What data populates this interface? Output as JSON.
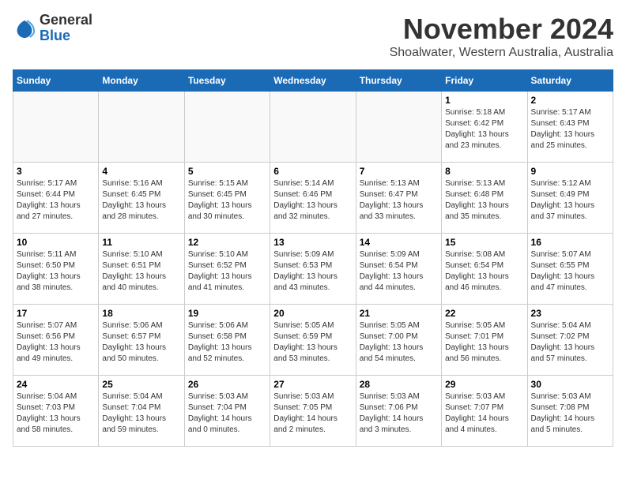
{
  "header": {
    "logo_line1": "General",
    "logo_line2": "Blue",
    "month_title": "November 2024",
    "location": "Shoalwater, Western Australia, Australia"
  },
  "days_of_week": [
    "Sunday",
    "Monday",
    "Tuesday",
    "Wednesday",
    "Thursday",
    "Friday",
    "Saturday"
  ],
  "weeks": [
    [
      {
        "day": "",
        "info": ""
      },
      {
        "day": "",
        "info": ""
      },
      {
        "day": "",
        "info": ""
      },
      {
        "day": "",
        "info": ""
      },
      {
        "day": "",
        "info": ""
      },
      {
        "day": "1",
        "info": "Sunrise: 5:18 AM\nSunset: 6:42 PM\nDaylight: 13 hours\nand 23 minutes."
      },
      {
        "day": "2",
        "info": "Sunrise: 5:17 AM\nSunset: 6:43 PM\nDaylight: 13 hours\nand 25 minutes."
      }
    ],
    [
      {
        "day": "3",
        "info": "Sunrise: 5:17 AM\nSunset: 6:44 PM\nDaylight: 13 hours\nand 27 minutes."
      },
      {
        "day": "4",
        "info": "Sunrise: 5:16 AM\nSunset: 6:45 PM\nDaylight: 13 hours\nand 28 minutes."
      },
      {
        "day": "5",
        "info": "Sunrise: 5:15 AM\nSunset: 6:45 PM\nDaylight: 13 hours\nand 30 minutes."
      },
      {
        "day": "6",
        "info": "Sunrise: 5:14 AM\nSunset: 6:46 PM\nDaylight: 13 hours\nand 32 minutes."
      },
      {
        "day": "7",
        "info": "Sunrise: 5:13 AM\nSunset: 6:47 PM\nDaylight: 13 hours\nand 33 minutes."
      },
      {
        "day": "8",
        "info": "Sunrise: 5:13 AM\nSunset: 6:48 PM\nDaylight: 13 hours\nand 35 minutes."
      },
      {
        "day": "9",
        "info": "Sunrise: 5:12 AM\nSunset: 6:49 PM\nDaylight: 13 hours\nand 37 minutes."
      }
    ],
    [
      {
        "day": "10",
        "info": "Sunrise: 5:11 AM\nSunset: 6:50 PM\nDaylight: 13 hours\nand 38 minutes."
      },
      {
        "day": "11",
        "info": "Sunrise: 5:10 AM\nSunset: 6:51 PM\nDaylight: 13 hours\nand 40 minutes."
      },
      {
        "day": "12",
        "info": "Sunrise: 5:10 AM\nSunset: 6:52 PM\nDaylight: 13 hours\nand 41 minutes."
      },
      {
        "day": "13",
        "info": "Sunrise: 5:09 AM\nSunset: 6:53 PM\nDaylight: 13 hours\nand 43 minutes."
      },
      {
        "day": "14",
        "info": "Sunrise: 5:09 AM\nSunset: 6:54 PM\nDaylight: 13 hours\nand 44 minutes."
      },
      {
        "day": "15",
        "info": "Sunrise: 5:08 AM\nSunset: 6:54 PM\nDaylight: 13 hours\nand 46 minutes."
      },
      {
        "day": "16",
        "info": "Sunrise: 5:07 AM\nSunset: 6:55 PM\nDaylight: 13 hours\nand 47 minutes."
      }
    ],
    [
      {
        "day": "17",
        "info": "Sunrise: 5:07 AM\nSunset: 6:56 PM\nDaylight: 13 hours\nand 49 minutes."
      },
      {
        "day": "18",
        "info": "Sunrise: 5:06 AM\nSunset: 6:57 PM\nDaylight: 13 hours\nand 50 minutes."
      },
      {
        "day": "19",
        "info": "Sunrise: 5:06 AM\nSunset: 6:58 PM\nDaylight: 13 hours\nand 52 minutes."
      },
      {
        "day": "20",
        "info": "Sunrise: 5:05 AM\nSunset: 6:59 PM\nDaylight: 13 hours\nand 53 minutes."
      },
      {
        "day": "21",
        "info": "Sunrise: 5:05 AM\nSunset: 7:00 PM\nDaylight: 13 hours\nand 54 minutes."
      },
      {
        "day": "22",
        "info": "Sunrise: 5:05 AM\nSunset: 7:01 PM\nDaylight: 13 hours\nand 56 minutes."
      },
      {
        "day": "23",
        "info": "Sunrise: 5:04 AM\nSunset: 7:02 PM\nDaylight: 13 hours\nand 57 minutes."
      }
    ],
    [
      {
        "day": "24",
        "info": "Sunrise: 5:04 AM\nSunset: 7:03 PM\nDaylight: 13 hours\nand 58 minutes."
      },
      {
        "day": "25",
        "info": "Sunrise: 5:04 AM\nSunset: 7:04 PM\nDaylight: 13 hours\nand 59 minutes."
      },
      {
        "day": "26",
        "info": "Sunrise: 5:03 AM\nSunset: 7:04 PM\nDaylight: 14 hours\nand 0 minutes."
      },
      {
        "day": "27",
        "info": "Sunrise: 5:03 AM\nSunset: 7:05 PM\nDaylight: 14 hours\nand 2 minutes."
      },
      {
        "day": "28",
        "info": "Sunrise: 5:03 AM\nSunset: 7:06 PM\nDaylight: 14 hours\nand 3 minutes."
      },
      {
        "day": "29",
        "info": "Sunrise: 5:03 AM\nSunset: 7:07 PM\nDaylight: 14 hours\nand 4 minutes."
      },
      {
        "day": "30",
        "info": "Sunrise: 5:03 AM\nSunset: 7:08 PM\nDaylight: 14 hours\nand 5 minutes."
      }
    ]
  ]
}
